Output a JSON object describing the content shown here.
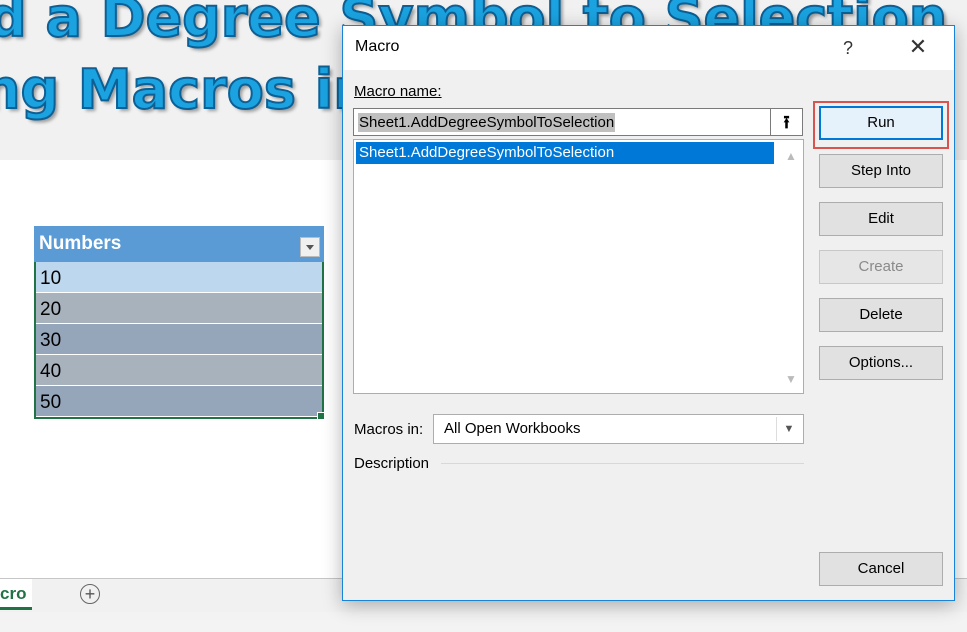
{
  "banner": {
    "line1": "d a Degree Symbol to Selection",
    "line2": "ng Macros in Excel"
  },
  "table": {
    "header": "Numbers",
    "rows": [
      "10",
      "20",
      "30",
      "40",
      "50"
    ]
  },
  "sheet_tab": {
    "label": "cro",
    "add_glyph": "+"
  },
  "dialog": {
    "title": "Macro",
    "help": "?",
    "close": "✕",
    "macro_name_label": "Macro name:",
    "macro_name_value": "Sheet1.AddDegreeSymbolToSelection",
    "macro_list": [
      "Sheet1.AddDegreeSymbolToSelection"
    ],
    "macros_in_label": "Macros in:",
    "macros_in_value": "All Open Workbooks",
    "description_label": "Description",
    "buttons": {
      "run": "Run",
      "step_into": "Step Into",
      "edit": "Edit",
      "create": "Create",
      "delete": "Delete",
      "options": "Options...",
      "cancel": "Cancel"
    },
    "upload_glyph": "⭱",
    "scroll_up": "▲",
    "scroll_down": "▼",
    "dropdown_glyph": "▼"
  },
  "colors": {
    "table_header": "#5b9bd5",
    "selection": "#0078d7",
    "highlight_frame": "#d9534f",
    "excel_green": "#217346"
  }
}
